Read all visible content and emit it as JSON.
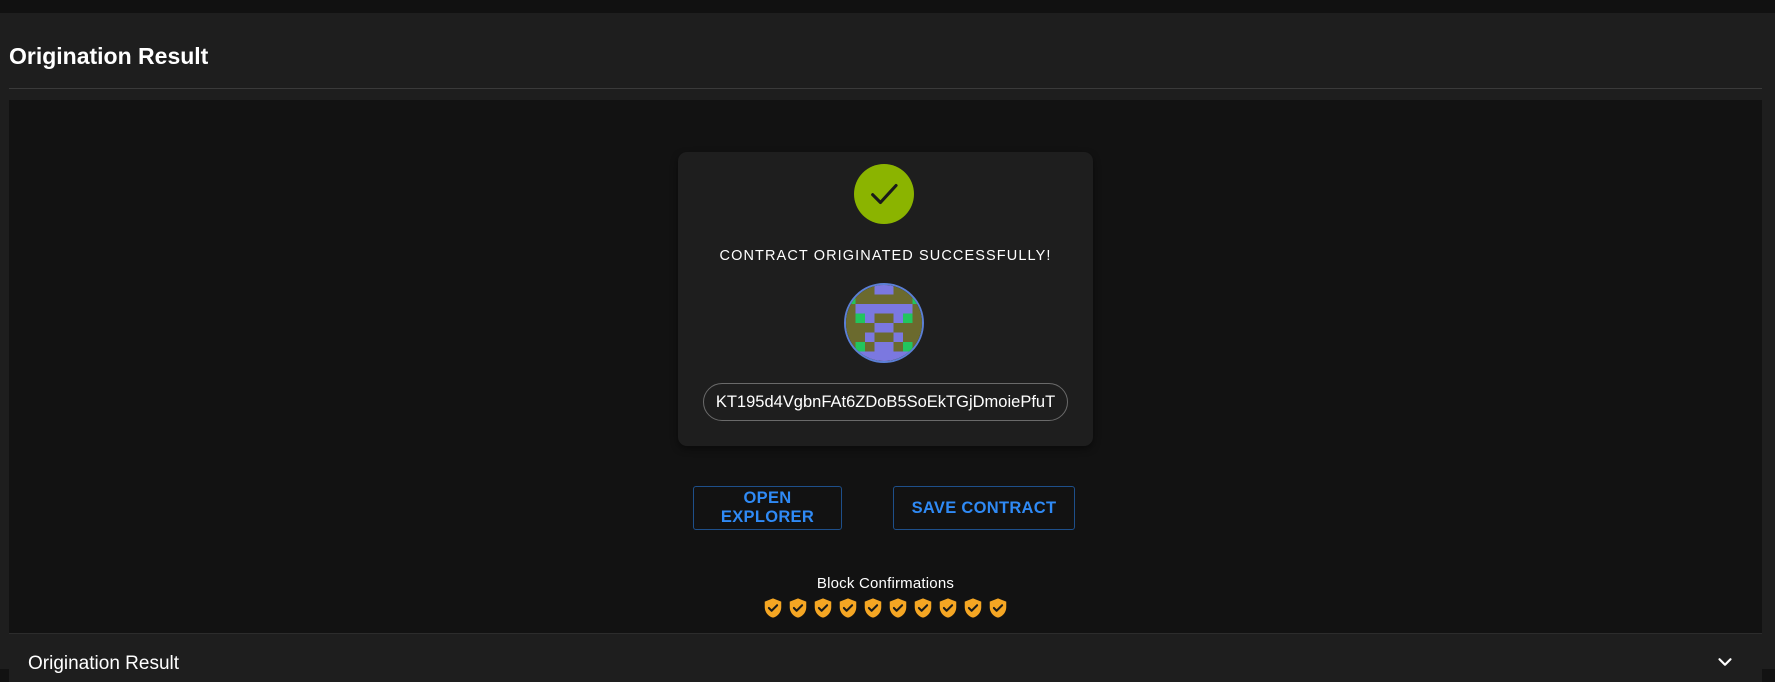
{
  "header": {
    "title": "Origination Result"
  },
  "result_card": {
    "success_message": "CONTRACT ORIGINATED SUCCESSFULLY!",
    "contract_address": "KT195d4VgbnFAt6ZDoB5SoEkTGjDmoiePfuT",
    "icons": {
      "status": "check-icon",
      "identicon": "contract-identicon"
    }
  },
  "actions": {
    "open_explorer_label": "OPEN EXPLORER",
    "save_contract_label": "SAVE CONTRACT"
  },
  "confirmations": {
    "label": "Block Confirmations",
    "count": 10,
    "icon": "shield-check-icon"
  },
  "accordion": {
    "title": "Origination Result",
    "icon": "chevron-down-icon"
  },
  "colors": {
    "success": "#8bb400",
    "accent": "#2f8af5",
    "confirmation": "#f5a623",
    "background": "#121212",
    "surface": "#1e1e1e"
  }
}
